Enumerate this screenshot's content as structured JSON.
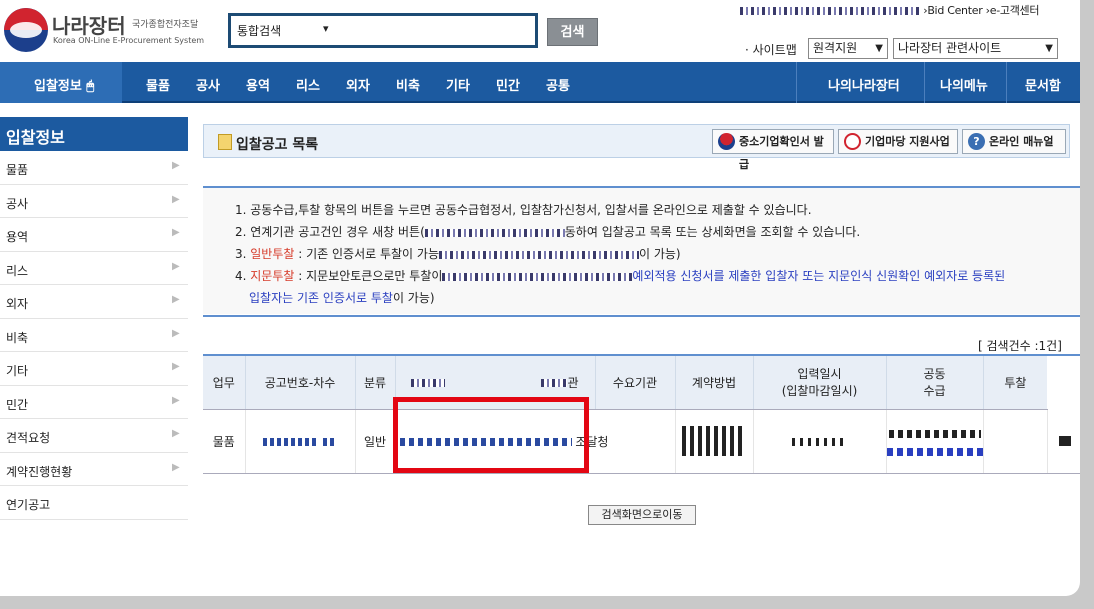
{
  "header": {
    "logo_main": "나라장터",
    "logo_sub": "국가종합전자조달",
    "logo_en": "Korea ON-Line E-Procurement System",
    "search_select": "통합검색",
    "search_button": "검색",
    "top_link_1": "Bid Center",
    "top_link_2": "e-고객센터",
    "sitemap_label": "· 사이트맵",
    "remote_select": "원격지원",
    "related_select": "나라장터 관련사이트"
  },
  "nav": {
    "first": "입찰정보",
    "items": [
      "물품",
      "공사",
      "용역",
      "리스",
      "외자",
      "비축",
      "기타",
      "민간",
      "공통"
    ],
    "right": [
      "나의나라장터",
      "나의메뉴",
      "문서함"
    ]
  },
  "sidebar": {
    "title": "입찰정보",
    "items": [
      "물품",
      "공사",
      "용역",
      "리스",
      "외자",
      "비축",
      "기타",
      "민간",
      "견적요청",
      "계약진행현황",
      "연기공고"
    ]
  },
  "page": {
    "title": "입찰공고 목록",
    "btn_sme": "중소기업확인서 발급",
    "btn_support": "기업마당 지원사업",
    "btn_manual": "온라인 매뉴얼",
    "notice_1": "1. 공동수급,투찰 항목의 버튼을 누르면 공동수급협정서, 입찰참가신청서, 입찰서를 온라인으로 제출할 수 있습니다.",
    "notice_2_pre": "2. 연계기관 공고건인 경우 새창 버튼(",
    "notice_2_post": "동하여 입찰공고 목록 또는 상세화면을 조회할 수 있습니다.",
    "notice_3_num": "3. ",
    "notice_3_red": "일반투찰",
    "notice_3_rest": " : 기존 인증서로 투찰이 가능",
    "notice_3_end": "이 가능)",
    "notice_4_num": "4. ",
    "notice_4_red": "지문투찰",
    "notice_4_rest": " : 지문보안토큰으로만 투찰이",
    "notice_4_blue": "예외적용 신청서를 제출한 입찰자 또는 지문인식 신원확인 예외자로 등록된",
    "notice_4_blue2": "입찰자는 기존 인증서로 투찰",
    "notice_4_end": "이 가능)",
    "count_label": "[ 검색건수 :1건]",
    "back_button": "검색화면으로이동"
  },
  "table": {
    "headers": [
      "업무",
      "공고번호-차수",
      "분류",
      "",
      "관",
      "수요기관",
      "계약방법",
      "입력일시\n(입찰마감일시)",
      "공동\n수급",
      "투찰"
    ],
    "row": {
      "type": "물품",
      "category": "일반",
      "agency": "조달청"
    }
  },
  "colors": {
    "nav_blue": "#1c5aa0",
    "highlight_red": "#e30613"
  }
}
